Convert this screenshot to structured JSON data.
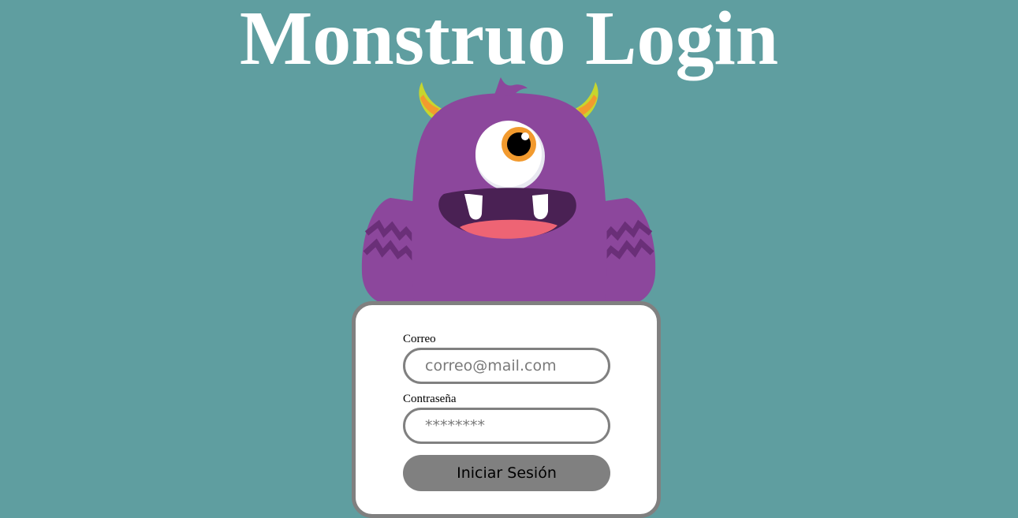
{
  "header": {
    "title": "Monstruo Login"
  },
  "illustration": {
    "icon": "purple-one-eyed-monster-icon",
    "colors": {
      "background": "#5f9ea0",
      "body": "#8c479c",
      "horn": "#c6d62e",
      "horn_stripe": "#f29a2e",
      "mouth": "#4a2154",
      "tongue": "#ee6474",
      "iris": "#f29a2e"
    }
  },
  "login_form": {
    "email": {
      "label": "Correo",
      "placeholder": "correo@mail.com",
      "value": ""
    },
    "password": {
      "label": "Contraseña",
      "placeholder": "********",
      "value": ""
    },
    "submit_label": "Iniciar Sesión",
    "colors": {
      "card_border": "#808080",
      "button_bg": "#808080"
    }
  }
}
